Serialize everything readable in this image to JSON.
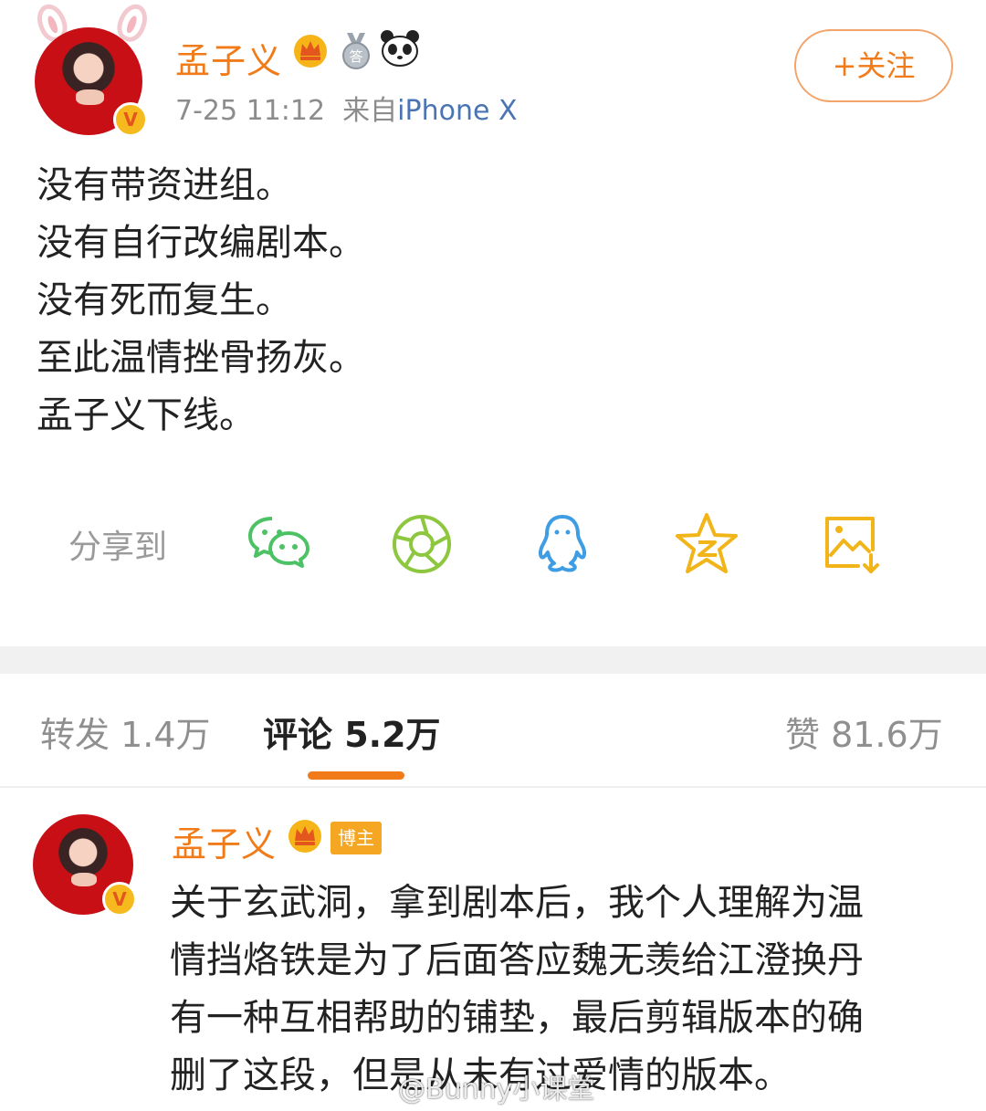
{
  "post": {
    "author": "孟子义",
    "timestamp": "7-25 11:12",
    "source_prefix": "来自",
    "source": "iPhone X",
    "follow_label": "+关注",
    "lines": [
      "没有带资进组。",
      "没有自行改编剧本。",
      "没有死而复生。",
      "至此温情挫骨扬灰。",
      "孟子义下线。"
    ]
  },
  "badges": {
    "verified": "V",
    "crown": "crown-icon",
    "medal": "medal-icon",
    "medal_char": "答",
    "panda": "panda-icon"
  },
  "share": {
    "label": "分享到",
    "targets": [
      "wechat-icon",
      "moments-icon",
      "qq-icon",
      "qzone-icon",
      "save-image-icon"
    ]
  },
  "tabs": {
    "repost": "转发 1.4万",
    "comments": "评论 5.2万",
    "likes": "赞 81.6万"
  },
  "comment": {
    "author": "孟子义",
    "author_badge": "博主",
    "lines": [
      "关于玄武洞，拿到剧本后，我个人理解为温",
      "情挡烙铁是为了后面答应魏无羡给江澄换丹",
      "有一种互相帮助的铺垫，最后剪辑版本的确",
      "删了这段，但是从未有过爱情的版本。"
    ]
  },
  "watermark": "@Bunny小课堂",
  "colors": {
    "accent": "#f07b18",
    "link": "#4a74b4",
    "wechat": "#4cc265",
    "moments": "#8dc73f",
    "qq": "#3f9de4",
    "qzone": "#f2b519",
    "save": "#f2b519"
  }
}
